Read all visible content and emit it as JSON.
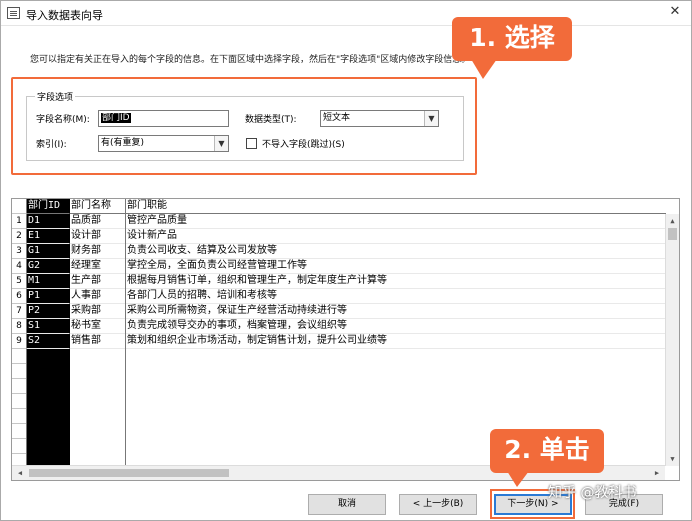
{
  "window": {
    "title": "导入数据表向导"
  },
  "description": "您可以指定有关正在导入的每个字段的信息。在下面区域中选择字段，然后在\"字段选项\"区域内修改字段信息。",
  "field_options": {
    "group_title": "字段选项",
    "field_name_label": "字段名称(M):",
    "field_name_value": "部门ID",
    "data_type_label": "数据类型(T):",
    "data_type_value": "短文本",
    "index_label": "索引(I):",
    "index_value": "有(有重复)",
    "skip_label": "不导入字段(跳过)(S)",
    "skip_checked": false
  },
  "grid": {
    "columns": [
      "部门ID",
      "部门名称",
      "部门职能"
    ],
    "rows": [
      {
        "num": "1",
        "id": "D1",
        "name": "品质部",
        "func": "管控产品质量"
      },
      {
        "num": "2",
        "id": "E1",
        "name": "设计部",
        "func": "设计新产品"
      },
      {
        "num": "3",
        "id": "G1",
        "name": "财务部",
        "func": "负责公司收支、结算及公司发放等"
      },
      {
        "num": "4",
        "id": "G2",
        "name": "经理室",
        "func": "掌控全局，全面负责公司经营管理工作等"
      },
      {
        "num": "5",
        "id": "M1",
        "name": "生产部",
        "func": "根据每月销售订单，组织和管理生产，制定年度生产计算等"
      },
      {
        "num": "6",
        "id": "P1",
        "name": "人事部",
        "func": "各部门人员的招聘、培训和考核等"
      },
      {
        "num": "7",
        "id": "P2",
        "name": "采购部",
        "func": "采购公司所需物资，保证生产经营活动持续进行等"
      },
      {
        "num": "8",
        "id": "S1",
        "name": "秘书室",
        "func": "负责完成领导交办的事项，档案管理，会议组织等"
      },
      {
        "num": "9",
        "id": "S2",
        "name": "销售部",
        "func": "策划和组织企业市场活动，制定销售计划，提升公司业绩等"
      }
    ]
  },
  "buttons": {
    "cancel": "取消",
    "back": "< 上一步(B)",
    "next": "下一步(N) >",
    "finish": "完成(F)"
  },
  "annotations": {
    "callout1": "1. 选择",
    "callout2": "2. 单击",
    "accent_color": "#f26b3a"
  },
  "watermark": "知乎 @教科书"
}
